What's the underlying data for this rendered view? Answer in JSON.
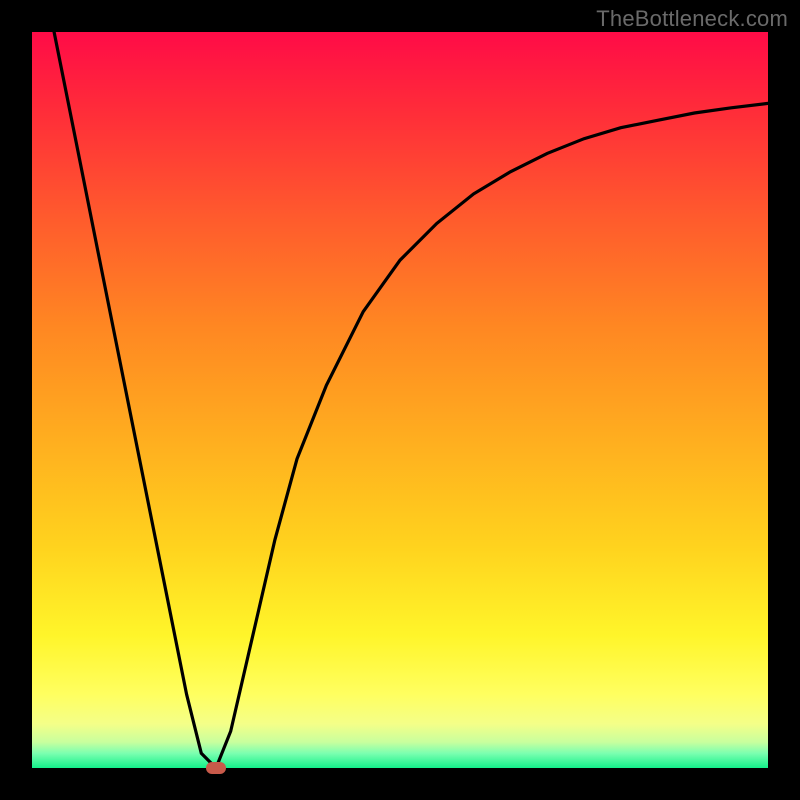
{
  "watermark": "TheBottleneck.com",
  "colors": {
    "frame": "#000000",
    "curve": "#000000",
    "marker": "#c85a4a",
    "gradient_stops": [
      "#ff0b47",
      "#ff2a3a",
      "#ff5a2d",
      "#ff8722",
      "#ffad1f",
      "#ffd31e",
      "#fff52a",
      "#ffff60",
      "#f4ff88",
      "#c8ff9e",
      "#7bffb0",
      "#13f08a"
    ]
  },
  "chart_data": {
    "type": "line",
    "title": "",
    "xlabel": "",
    "ylabel": "",
    "xlim": [
      0,
      100
    ],
    "ylim": [
      0,
      100
    ],
    "series": [
      {
        "name": "bottleneck-curve",
        "x": [
          3,
          6,
          9,
          12,
          15,
          18,
          21,
          23,
          25,
          27,
          30,
          33,
          36,
          40,
          45,
          50,
          55,
          60,
          65,
          70,
          75,
          80,
          85,
          90,
          95,
          100
        ],
        "y": [
          100,
          85,
          70,
          55,
          40,
          25,
          10,
          2,
          0,
          5,
          18,
          31,
          42,
          52,
          62,
          69,
          74,
          78,
          81,
          83.5,
          85.5,
          87,
          88,
          89,
          89.7,
          90.3
        ]
      }
    ],
    "marker": {
      "x": 25,
      "y": 0,
      "name": "optimal-point"
    },
    "grid": false,
    "legend": false
  }
}
